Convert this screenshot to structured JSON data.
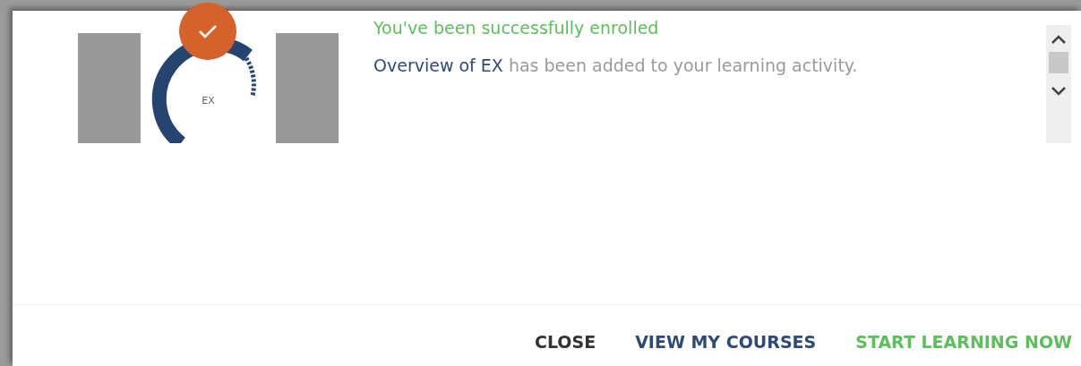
{
  "thumbnail": {
    "logo_text": "EX",
    "enrolled": true
  },
  "heading": "You've been successfully enrolled",
  "message": {
    "course": "Overview of EX",
    "text": "has been added to your learning activity."
  },
  "buttons": [
    {
      "label": "CLOSE",
      "kind": "neutral"
    },
    {
      "label": "VIEW MY COURSES",
      "kind": "secondary"
    },
    {
      "label": "START LEARNING NOW",
      "kind": "primary"
    }
  ]
}
